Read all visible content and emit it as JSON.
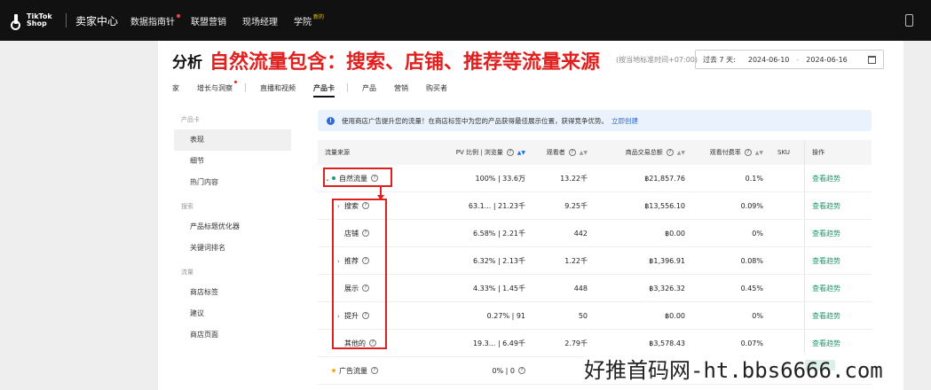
{
  "topbar": {
    "logo_line1": "TikTok",
    "logo_line2": "Shop",
    "seller_center": "卖家中心",
    "nav": [
      {
        "label": "数据指南针"
      },
      {
        "label": "联盟营销"
      },
      {
        "label": "现场经理"
      },
      {
        "label": "学院",
        "badge": "新的"
      }
    ]
  },
  "header": {
    "title": "分析",
    "annotation": "自然流量包含：搜索、店铺、推荐等流量来源",
    "timezone": "(按当地标准时间+07:00)",
    "range_label": "过去 7 天:",
    "date_start": "2024-06-10",
    "date_sep": "-",
    "date_end": "2024-06-16"
  },
  "tabs": [
    {
      "label": "家"
    },
    {
      "label": "增长与洞察"
    },
    {
      "label": "直播和视频"
    },
    {
      "label": "产品卡"
    },
    {
      "label": "产品"
    },
    {
      "label": "营销"
    },
    {
      "label": "购买者"
    }
  ],
  "sidebar": {
    "groups": [
      {
        "title": "产品卡",
        "items": [
          "表现",
          "细节",
          "热门内容"
        ]
      },
      {
        "title": "搜索",
        "items": [
          "产品标题优化器",
          "关键词排名"
        ]
      },
      {
        "title": "流量",
        "items": [
          "商店标签",
          "建议",
          "商店页面"
        ]
      }
    ]
  },
  "banner": {
    "icon": "info-icon",
    "text": "使用商店广告提升您的流量！在商店标签中为您的产品获得最佳展示位置，获得竞争优势。",
    "link": "立即创建"
  },
  "table": {
    "headers": [
      "流量来源",
      "PV 比例 | 浏览量",
      "观看者",
      "商品交易总额",
      "观看付费率",
      "SKU",
      "操作"
    ],
    "rows": [
      {
        "source": "自然流量",
        "pv": "100% | 33.6万",
        "viewers": "13.22千",
        "gmv": "฿21,857.76",
        "rate": "0.1%",
        "action": "查看趋势",
        "expanded": true,
        "dot_color": "#1a9b6a"
      },
      {
        "source": "搜索",
        "pv": "63.1... | 21.23千",
        "viewers": "9.25千",
        "gmv": "฿13,556.10",
        "rate": "0.09%",
        "action": "查看趋势",
        "expandable": true
      },
      {
        "source": "店铺",
        "pv": "6.58% | 2.21千",
        "viewers": "442",
        "gmv": "฿0.00",
        "rate": "0%",
        "action": "查看趋势"
      },
      {
        "source": "推荐",
        "pv": "6.32% | 2.13千",
        "viewers": "1.22千",
        "gmv": "฿1,396.91",
        "rate": "0.08%",
        "action": "查看趋势",
        "expandable": true
      },
      {
        "source": "展示",
        "pv": "4.33% | 1.45千",
        "viewers": "448",
        "gmv": "฿3,326.32",
        "rate": "0.45%",
        "action": "查看趋势"
      },
      {
        "source": "提升",
        "pv": "0.27% | 91",
        "viewers": "50",
        "gmv": "฿0.00",
        "rate": "0%",
        "action": "查看趋势",
        "expandable": true
      },
      {
        "source": "其他的",
        "pv": "19.3... | 6.49千",
        "viewers": "2.79千",
        "gmv": "฿3,578.43",
        "rate": "0.07%",
        "action": "查看趋势"
      },
      {
        "source": "广告流量",
        "pv": "0% | 0",
        "viewers": "",
        "gmv": "",
        "rate": "",
        "action": "",
        "dot_color": "#f2b01e"
      }
    ]
  },
  "watermark": "好推首码网-ht.bbs6666.com",
  "colors": {
    "accent_red": "#e0201f",
    "link_green": "#1a9b6a",
    "banner_bg": "#e9f2fd"
  }
}
